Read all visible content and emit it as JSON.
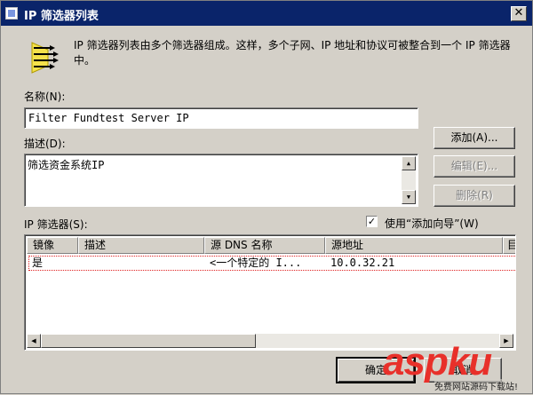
{
  "window": {
    "title": "IP 筛选器列表",
    "close_glyph": "✕"
  },
  "intro_text": "IP 筛选器列表由多个筛选器组成。这样，多个子网、IP 地址和协议可被整合到一个 IP 筛选器中。",
  "name": {
    "label": "名称(N):",
    "value": "Filter Fundtest Server IP"
  },
  "description": {
    "label": "描述(D):",
    "value": "筛选资金系统IP"
  },
  "buttons": {
    "add": "添加(A)...",
    "edit": "编辑(E)...",
    "delete": "删除(R)",
    "ok": "确定",
    "cancel": "取消"
  },
  "filters": {
    "label": "IP 筛选器(S):",
    "wizard_label": "使用“添加向导”(W)",
    "wizard_checked": "✓",
    "columns": [
      "镜像",
      "描述",
      "源 DNS 名称",
      "源地址",
      "目"
    ],
    "rows": [
      {
        "mirror": "是",
        "description": "",
        "source_dns": "<一个特定的 I...",
        "source_address": "10.0.32.21"
      }
    ]
  },
  "icons": {
    "scroll_up": "▲",
    "scroll_down": "▼",
    "scroll_left": "◀",
    "scroll_right": "▶"
  },
  "watermark": {
    "text": "aspku",
    "subtitle": "免费网站源码下载站!"
  },
  "colors": {
    "titlebar": "#0a246a",
    "face": "#d4d0c8",
    "watermark": "#e8302a"
  }
}
